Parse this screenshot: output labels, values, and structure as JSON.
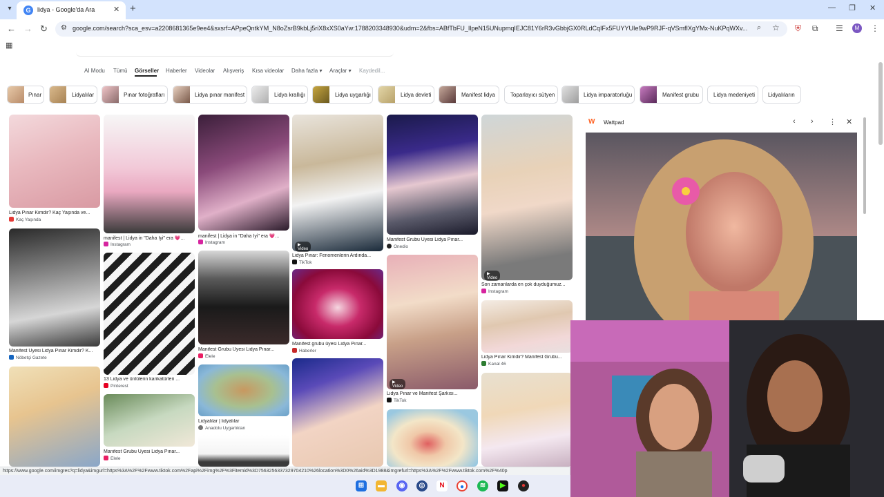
{
  "browser": {
    "tab_title": "lidya - Google'da Ara",
    "url": "google.com/search?sca_esv=a2208681365e9ee4&sxsrf=APpeQntkYM_N8oZsrB9kbLj5riX8xXS0aYw:1788203348930&udm=2&fbs=ABfTbFU_IlpeN15UNupmqIEJC81Y6rR3vGbbjGX0RLdCqIFx5FUYYUIe9wP9RJF-qVSmfIXgYMx-NuKPqWXv..."
  },
  "search_tabs": [
    "AI Modu",
    "Tümü",
    "Görseller",
    "Haberler",
    "Videolar",
    "Alışveriş",
    "Kısa videolar",
    "Daha fazla ▾",
    "Araçlar ▾",
    "Kaydedil..."
  ],
  "chips": [
    "Pınar",
    "Lidyalılar",
    "Pınar fotoğrafları",
    "Lidya pınar manifest",
    "Lidya krallığı",
    "Lidya uygarlığı",
    "Lidya devleti",
    "Manifest lidya",
    "Toparlayıcı sütyen",
    "Lidya imparatorluğu",
    "Manifest grubu",
    "Lidya medeniyeti",
    "Lidyalıların"
  ],
  "results": [
    {
      "caption": "Lidya Pınar Kimdir? Kaç Yaşında ve...",
      "source": "Kaç Yaşında"
    },
    {
      "caption": "Manifest Üyesi Lidya Pınar Kimdir? K...",
      "source": "Nöbetçi Gazete"
    },
    {
      "caption": "",
      "source": ""
    },
    {
      "caption": "manifest | Lidya in \"Daha İyi\" era 💗...",
      "source": "Instagram"
    },
    {
      "caption": "13 Lidya ve ünlülerin karikatürleri ...",
      "source": "Pinterest"
    },
    {
      "caption": "Manifest Grubu Üyesi Lidya Pınar...",
      "source": "Elele"
    },
    {
      "caption": "manifest | Lidya in \"Daha İyi\" era 💗...",
      "source": "Instagram"
    },
    {
      "caption": "Manifest Grubu Üyesi Lidya Pınar...",
      "source": "Elele"
    },
    {
      "caption": "Lidyalılar | lidyalılar",
      "source": "Anadolu Uygarlıkları"
    },
    {
      "caption": "Lidya Pınar: Fenomenlerin Ardında...",
      "source": "TikTok"
    },
    {
      "caption": "Manifest grubu üyesi Lidya Pınar...",
      "source": "Haberler"
    },
    {
      "caption": "",
      "source": ""
    },
    {
      "caption": "Manifest Grubu Üyesi Lidya Pınar...",
      "source": "Onedio"
    },
    {
      "caption": "Lidya Pınar ve Manifest Şarkısı...",
      "source": "TikTok"
    },
    {
      "caption": "",
      "source": ""
    },
    {
      "caption": "Son zamanlarda en çok duyduğumuz...",
      "source": "Instagram"
    },
    {
      "caption": "Lidya Pınar Kimdir? Manifest Grubu...",
      "source": "Kanal 46"
    },
    {
      "caption": "",
      "source": ""
    }
  ],
  "video_badge": "▶ Video",
  "side_panel": {
    "source": "Wattpad"
  },
  "status_url": "https://www.google.com/imgres?q=lidya&imgurl=https%3A%2F%2Fwww.tiktok.com%2Fapi%2Fimg%2F%3Fitemid%3D7563256337329704210%26location%3D0%26aid%3D1988&imgrefurl=https%3A%2F%2Fwww.tiktok.com%2F%40p",
  "colors": {
    "accent": "#1a73e8",
    "tabstrip": "#d3e3fd",
    "omnibox": "#eef2fa",
    "wattpad": "#ff6122"
  },
  "icons": {
    "back": "arrow-left-icon",
    "forward": "arrow-right-icon",
    "reload": "reload-icon",
    "lens": "lens-icon",
    "star": "star-icon"
  }
}
